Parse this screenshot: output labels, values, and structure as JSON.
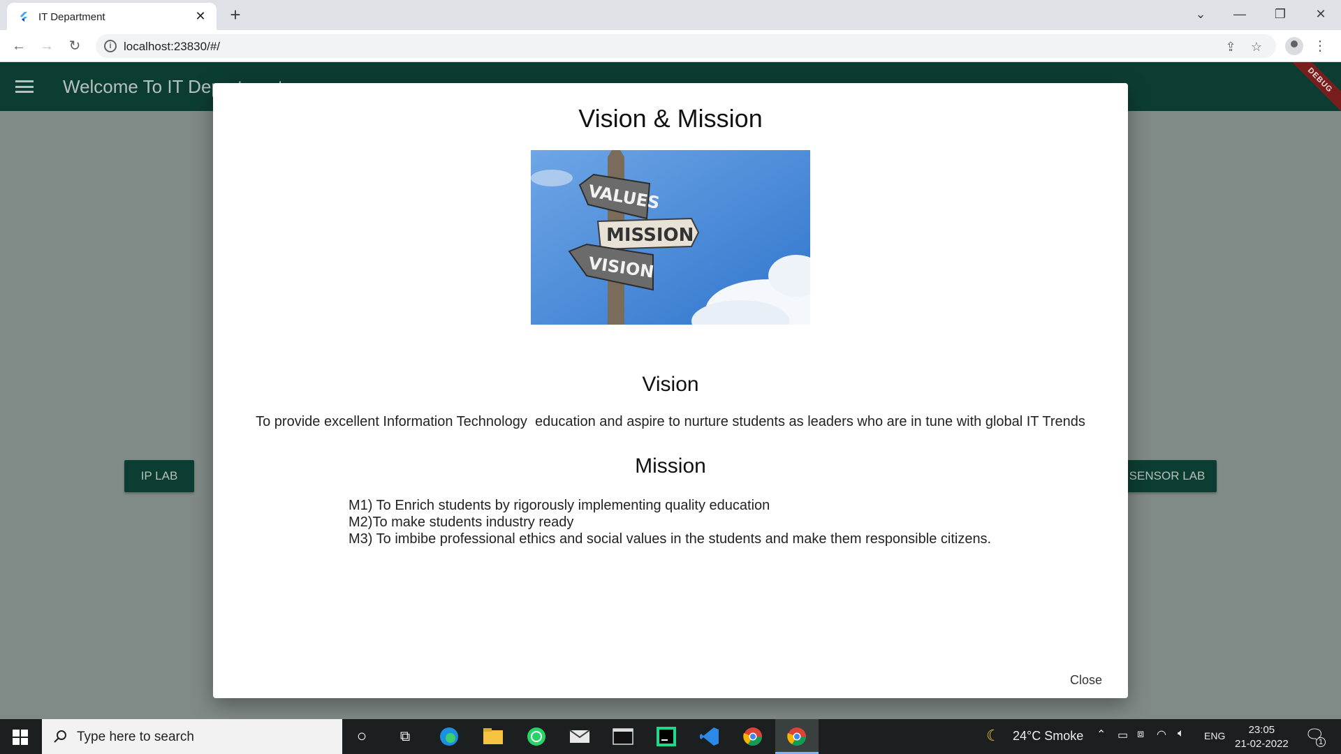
{
  "browser": {
    "tab_title": "IT Department",
    "tab_close": "✕",
    "new_tab": "+",
    "url": "localhost:23830/#/",
    "window_controls": {
      "menu": "⌄",
      "minimize": "—",
      "restore": "❐",
      "close": "✕"
    }
  },
  "app": {
    "title": "Welcome To IT Department",
    "debug_banner": "DEBUG",
    "buttons": {
      "left": "IP LAB",
      "right": "SENSOR LAB"
    },
    "accent": "#0c3d33"
  },
  "dialog": {
    "title": "Vision & Mission",
    "image_words": [
      "VALUES",
      "MISSION",
      "VISION"
    ],
    "vision_heading": "Vision",
    "vision_text": "To provide excellent Information Technology  education and aspire to nurture students as leaders who are in tune with global IT Trends",
    "mission_heading": "Mission",
    "mission_items": [
      "M1) To Enrich students by rigorously implementing quality education",
      "M2)To make students industry ready",
      "M3) To imbibe professional ethics and social values in the students and make them responsible citizens."
    ],
    "close_label": "Close"
  },
  "taskbar": {
    "search_placeholder": "Type here to search",
    "weather": "24°C  Smoke",
    "language": "ENG",
    "time": "23:05",
    "date": "21-02-2022",
    "notification_count": "1"
  }
}
